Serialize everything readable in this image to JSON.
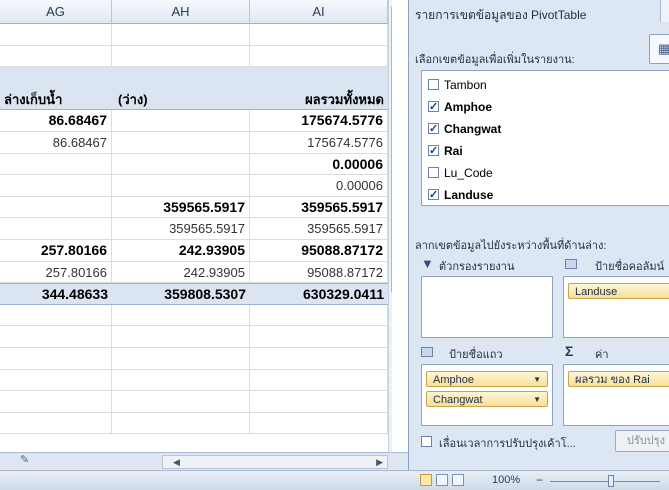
{
  "columns": [
    "AG",
    "AH",
    "AI"
  ],
  "rows": [
    {
      "style": "blank",
      "cells": [
        "",
        "",
        ""
      ]
    },
    {
      "style": "blank",
      "cells": [
        "",
        "",
        ""
      ]
    },
    {
      "style": "topband",
      "cells": [
        "",
        "",
        ""
      ]
    },
    {
      "style": "hdrrow",
      "cells": [
        "ล่างเก็บน้ำ",
        "(ว่าง)",
        "ผลรวมทั้งหมด"
      ]
    },
    {
      "style": "boldrow",
      "cells": [
        "86.68467",
        "",
        "175674.5776"
      ]
    },
    {
      "style": "sub",
      "cells": [
        "86.68467",
        "",
        "175674.5776"
      ]
    },
    {
      "style": "boldrow",
      "cells": [
        "",
        "",
        "0.00006"
      ]
    },
    {
      "style": "sub",
      "cells": [
        "",
        "",
        "0.00006"
      ]
    },
    {
      "style": "boldrow",
      "cells": [
        "",
        "359565.5917",
        "359565.5917"
      ]
    },
    {
      "style": "sub",
      "cells": [
        "",
        "359565.5917",
        "359565.5917"
      ]
    },
    {
      "style": "boldrow",
      "cells": [
        "257.80166",
        "242.93905",
        "95088.87172"
      ]
    },
    {
      "style": "sub",
      "cells": [
        "257.80166",
        "242.93905",
        "95088.87172"
      ]
    },
    {
      "style": "totrow",
      "cells": [
        "344.48633",
        "359808.5307",
        "630329.0411"
      ]
    },
    {
      "style": "blank",
      "cells": [
        "",
        "",
        ""
      ]
    },
    {
      "style": "blank",
      "cells": [
        "",
        "",
        ""
      ]
    },
    {
      "style": "blank",
      "cells": [
        "",
        "",
        ""
      ]
    },
    {
      "style": "blank",
      "cells": [
        "",
        "",
        ""
      ]
    },
    {
      "style": "blank",
      "cells": [
        "",
        "",
        ""
      ]
    },
    {
      "style": "blank",
      "cells": [
        "",
        "",
        ""
      ]
    }
  ],
  "pivot": {
    "title": "รายการเขตข้อมูลของ PivotTable",
    "choose_label": "เลือกเขตข้อมูลเพื่อเพิ่มในรายงาน:",
    "fields": [
      {
        "name": "Tambon",
        "checked": false
      },
      {
        "name": "Amphoe",
        "checked": true
      },
      {
        "name": "Changwat",
        "checked": true
      },
      {
        "name": "Rai",
        "checked": true
      },
      {
        "name": "Lu_Code",
        "checked": false
      },
      {
        "name": "Landuse",
        "checked": true
      }
    ],
    "drag_label": "ลากเขตข้อมูลไปยังระหว่างพื้นที่ด้านล่าง:",
    "zone_filter": "ตัวกรองรายงาน",
    "zone_columns": "ป้ายชื่อคอลัมน์",
    "zone_rows": "ป้ายชื่อแถว",
    "zone_values": "ค่า",
    "column_items": [
      "Landuse"
    ],
    "row_items": [
      "Amphoe",
      "Changwat"
    ],
    "value_items": [
      "ผลรวม ของ Rai"
    ],
    "defer_label": "เลื่อนเวลาการปรับปรุงเค้าโ...",
    "update_label": "ปรับปรุง"
  },
  "status": {
    "zoom": "100%",
    "minus": "−"
  }
}
